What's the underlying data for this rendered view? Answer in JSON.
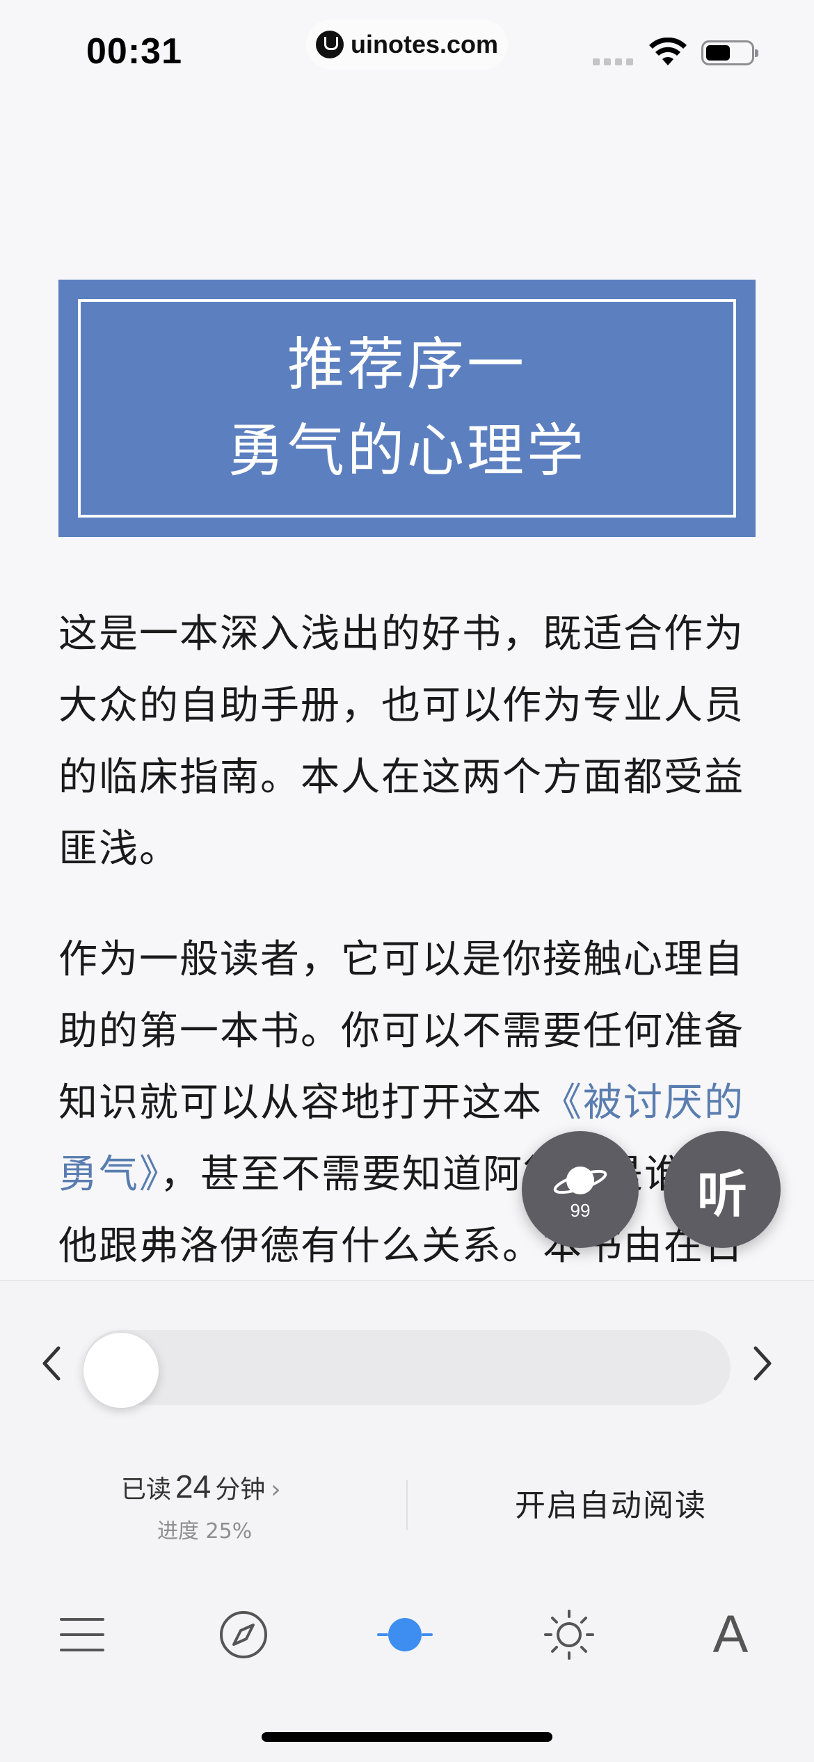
{
  "status_bar": {
    "time": "00:31",
    "watermark": "uinotes.com",
    "wifi_icon": "wifi-icon",
    "battery_icon": "battery-icon"
  },
  "chapter": {
    "title_line1": "推荐序一",
    "title_line2": "勇气的心理学",
    "banner_color": "#5c7fc0"
  },
  "content": {
    "paragraph1": "这是一本深入浅出的好书，既适合作为大众的自助手册，也可以作为专业人员的临床指南。本人在这两个方面都受益匪浅。",
    "paragraph2_before": "作为一般读者，它可以是你接触心理自助的第一本书。你可以不需要任何准备知识就可以从容地打开这本",
    "paragraph2_link": "《被讨厌的勇气》",
    "paragraph2_after": "，甚至不需要知道阿德勒是谁，他跟弗洛伊德有什么关系。本书由在日",
    "link_color": "#5a7db0"
  },
  "floating": {
    "planet_count": "99",
    "listen_label": "听"
  },
  "reader_panel": {
    "progress_fraction": 0,
    "read_prefix": "已读",
    "read_minutes": "24",
    "read_suffix": "分钟",
    "progress_text": "进度 25%",
    "auto_read_label": "开启自动阅读"
  },
  "toolbar": {
    "font_label": "A",
    "accent_color": "#3d8ef0"
  }
}
